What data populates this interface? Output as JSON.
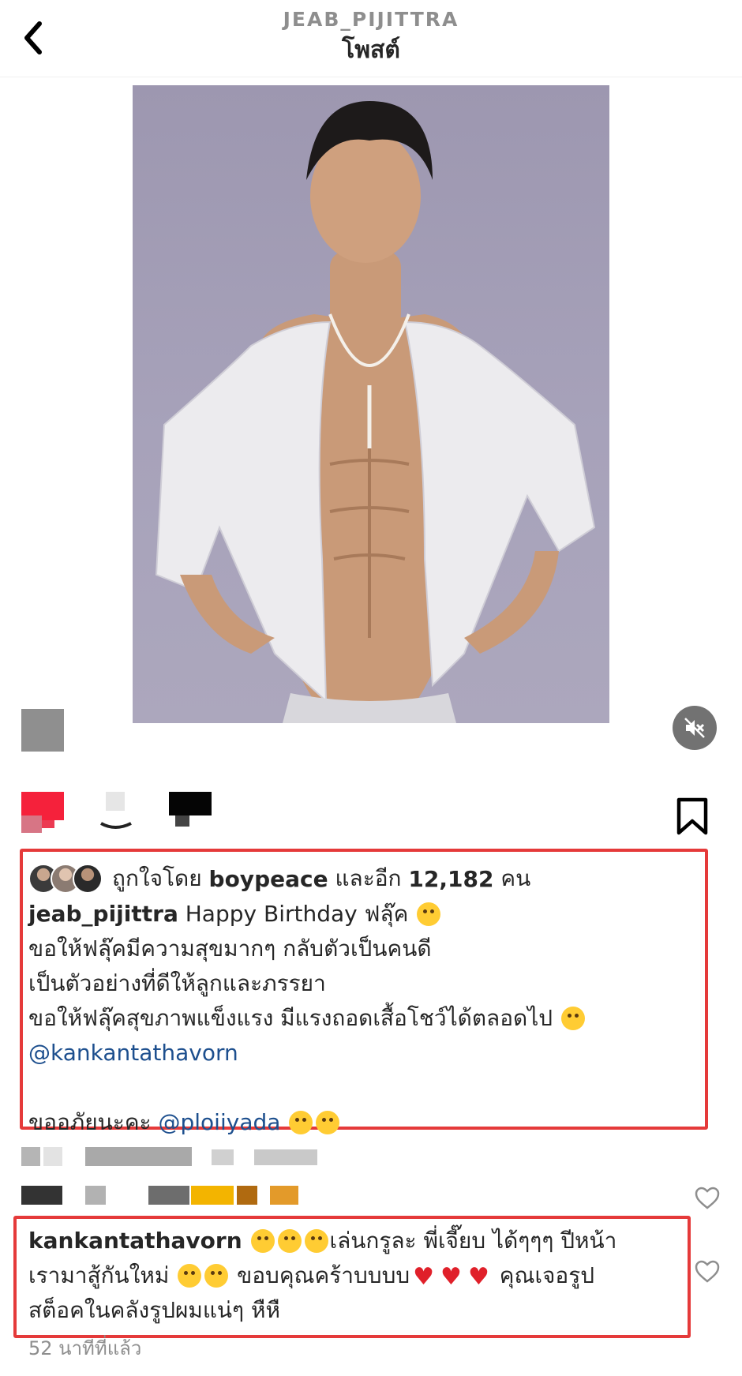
{
  "header": {
    "username": "JEAB_PIJITTRA",
    "title": "โพสต์"
  },
  "icons": {
    "back": "chevron-left-icon",
    "mute": "speaker-muted-icon",
    "like": "heart-icon",
    "comment": "comment-icon",
    "share": "send-icon",
    "save": "bookmark-icon"
  },
  "likes": {
    "prefix": "ถูกใจโดย",
    "user": "boypeace",
    "middle": "และอีก",
    "count": "12,182",
    "suffix": "คน"
  },
  "caption": {
    "author": "jeab_pijittra",
    "line1": "Happy Birthday  ฟลุ๊ค",
    "line2": "ขอให้ฟลุ๊คมีความสุขมากๆ กลับตัวเป็นคนดี",
    "line3": "เป็นตัวอย่างที่ดีให้ลูกและภรรยา",
    "line4": " ขอให้ฟลุ๊คสุขภาพแข็งแรง มีแรงถอดเสื้อโชว์ได้ตลอดไป",
    "mention1": "@kankantathavorn",
    "line6": "ขออภัยนะคะ",
    "mention2": "@ploiiyada"
  },
  "comment": {
    "author": "kankantathavorn",
    "text1": "เล่นกรูละ พี่เจี๊ยบ ได้ๆๆๆ  ปีหน้า",
    "text2a": "เรามาสู้กันใหม่",
    "text2b": "ขอบคุณคร้าบบบบ",
    "text2c": "คุณเจอรูป",
    "text3": "สต็อคในคลังรูปผมแน่ๆ หืหื"
  },
  "timestamp": "52 นาทีที่แล้ว",
  "colors": {
    "highlight_box": "#e53a3a",
    "mention": "#1d4f8e",
    "muted_text": "#8e8e8e"
  }
}
